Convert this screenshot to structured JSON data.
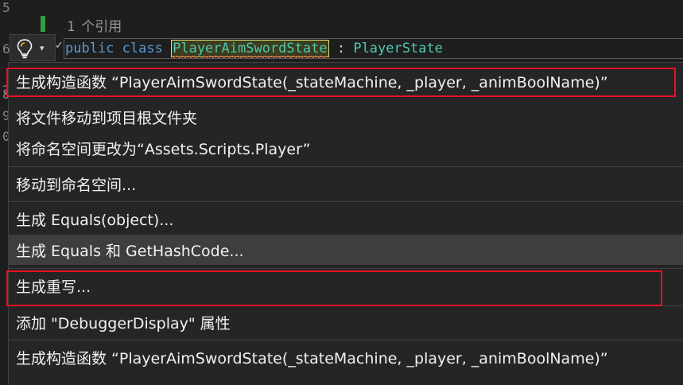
{
  "editor": {
    "line_numbers": [
      "5",
      "6",
      "7",
      "8",
      "9",
      "0"
    ],
    "codelens_count": "1",
    "codelens_text": "个引用",
    "code": {
      "kw_public": "public",
      "kw_class": "class",
      "class_name": "PlayerAimSwordState",
      "colon": ":",
      "base_class": "PlayerState"
    }
  },
  "lightbulb": {
    "icon": "lightbulb-icon",
    "dropdown_icon": "▾",
    "check_icon": "✓"
  },
  "menu": {
    "items": [
      {
        "label": "生成构造函数 “PlayerAimSwordState(_stateMachine, _player, _animBoolName)”"
      },
      {
        "label": "将文件移动到项目根文件夹"
      },
      {
        "label": "将命名空间更改为“Assets.Scripts.Player”"
      },
      {
        "label": "移动到命名空间..."
      },
      {
        "label": "生成 Equals(object)..."
      },
      {
        "label": "生成 Equals 和 GetHashCode..."
      },
      {
        "label": "生成重写..."
      },
      {
        "label": "添加 \"DebuggerDisplay\" 属性"
      },
      {
        "label": "生成构造函数 “PlayerAimSwordState(_stateMachine, _player, _animBoolName)”"
      }
    ]
  },
  "colors": {
    "background": "#1e1e1e",
    "menu_background": "#252526",
    "highlight_border": "#e81123",
    "keyword": "#569cd6",
    "type": "#4ec9b0"
  }
}
